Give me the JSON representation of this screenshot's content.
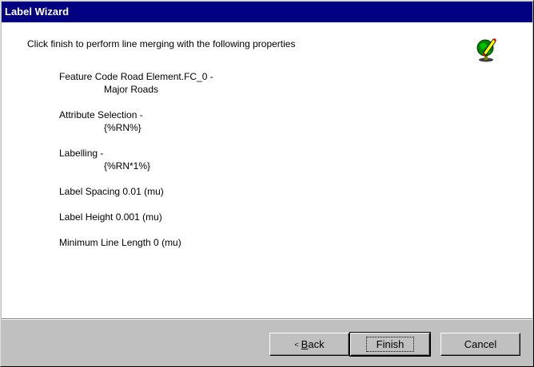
{
  "window": {
    "title": "Label Wizard"
  },
  "intro": "Click finish to perform line merging with the following properties",
  "properties": [
    {
      "label": "Feature Code Road Element.FC_0 -",
      "value": "Major Roads"
    },
    {
      "label": "Attribute Selection -",
      "value": "{%RN%}"
    },
    {
      "label": "Labelling -",
      "value": "{%RN*1%}"
    },
    {
      "label": "Label Spacing 0.01 (mu)"
    },
    {
      "label": "Label Height 0.001 (mu)"
    },
    {
      "label": "Minimum Line Length 0 (mu)"
    }
  ],
  "icon": "globe-pencil-icon",
  "buttons": {
    "back_arrow": "<",
    "back_first": "B",
    "back_rest": "ack",
    "finish": "Finish",
    "cancel": "Cancel"
  }
}
